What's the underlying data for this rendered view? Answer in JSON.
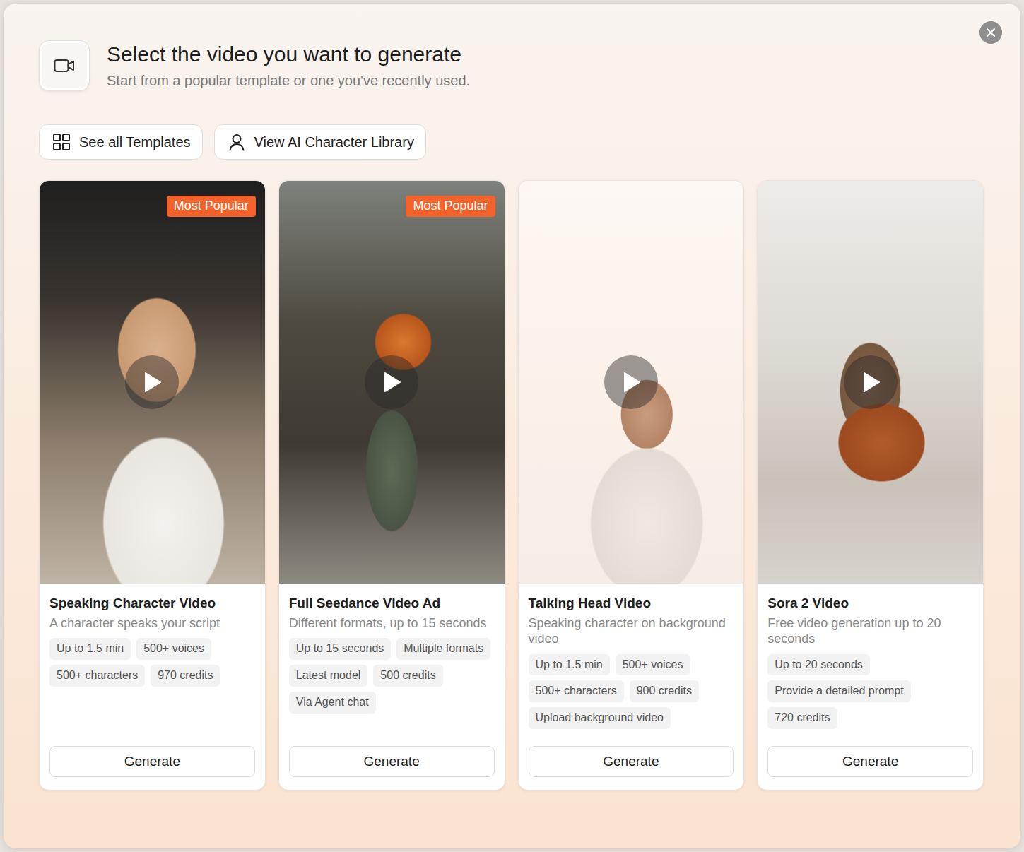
{
  "dialog": {
    "title": "Select the video you want to generate",
    "subtitle": "Start from a popular template or one you've recently used."
  },
  "actions": [
    {
      "label": "See all Templates"
    },
    {
      "label": "View AI Character Library"
    }
  ],
  "templates": [
    {
      "title": "Speaking Character Video",
      "description": "A character speaks your script",
      "badge": "Most Popular",
      "tags": [
        "Up to 1.5 min",
        "500+ voices",
        "500+ characters",
        "970 credits"
      ],
      "button": "Generate"
    },
    {
      "title": "Full Seedance Video Ad",
      "description": "Different formats, up to 15 seconds",
      "badge": "Most Popular",
      "tags": [
        "Up to 15 seconds",
        "Multiple formats",
        "Latest model",
        "500 credits",
        "Via Agent chat"
      ],
      "button": "Generate"
    },
    {
      "title": "Talking Head Video",
      "description": "Speaking character on background video",
      "tags": [
        "Up to 1.5 min",
        "500+ voices",
        "500+ characters",
        "900 credits",
        "Upload background video"
      ],
      "button": "Generate"
    },
    {
      "title": "Sora 2 Video",
      "description": "Free video generation up to 20 seconds",
      "tags": [
        "Up to 20 seconds",
        "Provide a detailed prompt",
        "720 credits"
      ],
      "button": "Generate"
    }
  ]
}
